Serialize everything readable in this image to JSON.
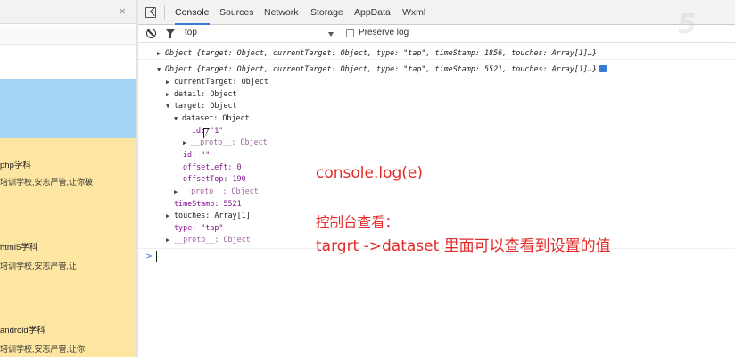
{
  "simulator": {
    "close": "×",
    "items": [
      {
        "title": "php学科",
        "desc": "培训学校,安志严管,让你破"
      },
      {
        "title": "html5学科",
        "desc": "培训学校,安志严管,让"
      },
      {
        "title": "android学科",
        "desc": "培训学校,安志严管,让你"
      }
    ]
  },
  "devtools": {
    "tabs": [
      "Console",
      "Sources",
      "Network",
      "Storage",
      "AppData",
      "Wxml"
    ],
    "active_tab": "Console",
    "context": "top",
    "preserve_log": "Preserve log"
  },
  "console": {
    "line1": "Object {target: Object, currentTarget: Object, type: \"tap\", timeStamp: 1856, touches: Array[1]…}",
    "line2": "Object {target: Object, currentTarget: Object, type: \"tap\", timeStamp: 5521, touches: Array[1]…}",
    "tree": [
      "currentTarget: Object",
      "detail: Object",
      "target: Object",
      "dataset: Object",
      "id: \"1\"",
      "__proto__: Object",
      "id: \"\"",
      "offsetLeft: 0",
      "offsetTop: 190",
      "__proto__: Object",
      "timeStamp: 5521",
      "touches: Array[1]",
      "type: \"tap\"",
      "__proto__: Object"
    ],
    "prompt": ">"
  },
  "annotation": {
    "line1": "console.log(e)",
    "line2": "控制台查看：",
    "line3": "targrt ->dataset  里面可以查看到设置的值"
  },
  "colors": {
    "tab_active": "#3879d9",
    "annotation": "#e32b2b",
    "blue_block": "#a6d4f5",
    "yellow_block": "#fde6a2"
  }
}
